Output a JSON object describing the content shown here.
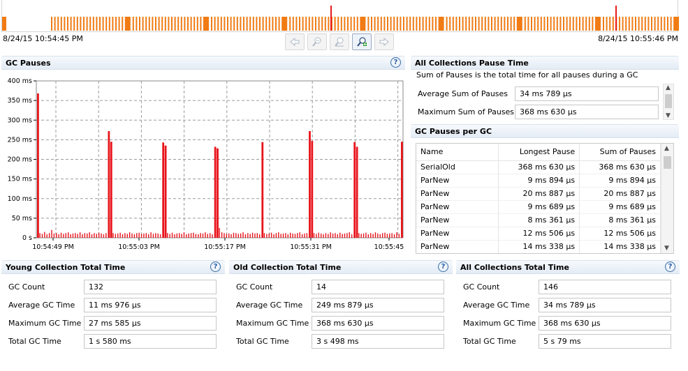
{
  "timeline": {
    "start_label": "8/24/15 10:54:45 PM",
    "end_label": "8/24/15 10:55:46 PM"
  },
  "toolbar": {
    "buttons": [
      "back-icon",
      "zoom-out-icon",
      "zoom-reset-icon",
      "zoom-in-icon",
      "forward-icon"
    ]
  },
  "gc_pauses": {
    "title": "GC Pauses",
    "help": "?",
    "chart_data": {
      "type": "bar",
      "title": "GC Pauses",
      "y_unit": "ms",
      "ylim": [
        0,
        400
      ],
      "y_ticks": [
        "0 s",
        "50 ms",
        "100 ms",
        "150 ms",
        "200 ms",
        "250 ms",
        "300 ms",
        "350 ms",
        "400 ms"
      ],
      "x_ticks": [
        "10:54:49 PM",
        "10:55:03 PM",
        "10:55:17 PM",
        "10:55:31 PM",
        "10:55:45"
      ],
      "grid": true,
      "color": "#e8141b",
      "series": [
        {
          "values": [
            368,
            12,
            10,
            15,
            9,
            12,
            20,
            11,
            12,
            9,
            13,
            10,
            12,
            14,
            9,
            11,
            12,
            10,
            14,
            9,
            12,
            11,
            14,
            9,
            12,
            10,
            13,
            11,
            9,
            12,
            272,
            245,
            12,
            10,
            11,
            13,
            9,
            12,
            10,
            14,
            11,
            9,
            12,
            13,
            10,
            11,
            12,
            9,
            14,
            10,
            12,
            11,
            9,
            243,
            235,
            12,
            10,
            13,
            9,
            11,
            12,
            10,
            14,
            9,
            11,
            12,
            13,
            10,
            9,
            12,
            11,
            14,
            10,
            12,
            9,
            232,
            228,
            25,
            14,
            12,
            10,
            11,
            9,
            13,
            12,
            10,
            11,
            14,
            9,
            12,
            10,
            13,
            11,
            12,
            9,
            244,
            12,
            10,
            11,
            13,
            9,
            12,
            14,
            10,
            11,
            12,
            9,
            13,
            11,
            10,
            12,
            14,
            9,
            11,
            12,
            272,
            247,
            12,
            10,
            13,
            11,
            9,
            12,
            10,
            14,
            11,
            12,
            9,
            13,
            10,
            11,
            12,
            14,
            9,
            244,
            232,
            12,
            10,
            11,
            13,
            9,
            12,
            10,
            14,
            11,
            9,
            12,
            13,
            10,
            11,
            12,
            9,
            14,
            10,
            245
          ]
        }
      ]
    }
  },
  "all_collections_pause": {
    "title": "All Collections Pause Time",
    "description": "Sum of Pauses is the total time for all pauses during a GC",
    "fields": [
      {
        "label": "Average Sum of Pauses",
        "value": "34 ms 789 µs"
      },
      {
        "label": "Maximum Sum of Pauses",
        "value": "368 ms 630 µs"
      }
    ]
  },
  "gc_pauses_per_gc": {
    "title": "GC Pauses per GC",
    "columns": [
      "Name",
      "Longest Pause",
      "Sum of Pauses"
    ],
    "rows": [
      [
        "SerialOld",
        "368 ms 630 µs",
        "368 ms 630 µs"
      ],
      [
        "ParNew",
        "9 ms 894 µs",
        "9 ms 894 µs"
      ],
      [
        "ParNew",
        "20 ms 887 µs",
        "20 ms 887 µs"
      ],
      [
        "ParNew",
        "9 ms 689 µs",
        "9 ms 689 µs"
      ],
      [
        "ParNew",
        "8 ms 361 µs",
        "8 ms 361 µs"
      ],
      [
        "ParNew",
        "12 ms 506 µs",
        "12 ms 506 µs"
      ],
      [
        "ParNew",
        "14 ms 338 µs",
        "14 ms 338 µs"
      ]
    ]
  },
  "young": {
    "title": "Young Collection Total Time",
    "fields": [
      {
        "label": "GC Count",
        "value": "132"
      },
      {
        "label": "Average GC Time",
        "value": "11 ms 976 µs"
      },
      {
        "label": "Maximum GC Time",
        "value": "27 ms 585 µs"
      },
      {
        "label": "Total GC Time",
        "value": "1 s 580 ms"
      }
    ]
  },
  "old": {
    "title": "Old Collection Total Time",
    "fields": [
      {
        "label": "GC Count",
        "value": "14"
      },
      {
        "label": "Average GC Time",
        "value": "249 ms 879 µs"
      },
      {
        "label": "Maximum GC Time",
        "value": "368 ms 630 µs"
      },
      {
        "label": "Total GC Time",
        "value": "3 s 498 ms"
      }
    ]
  },
  "all": {
    "title": "All Collections Total Time",
    "fields": [
      {
        "label": "GC Count",
        "value": "146"
      },
      {
        "label": "Average GC Time",
        "value": "34 ms 789 µs"
      },
      {
        "label": "Maximum GC Time",
        "value": "368 ms 630 µs"
      },
      {
        "label": "Total GC Time",
        "value": "5 s 79 ms"
      }
    ]
  }
}
